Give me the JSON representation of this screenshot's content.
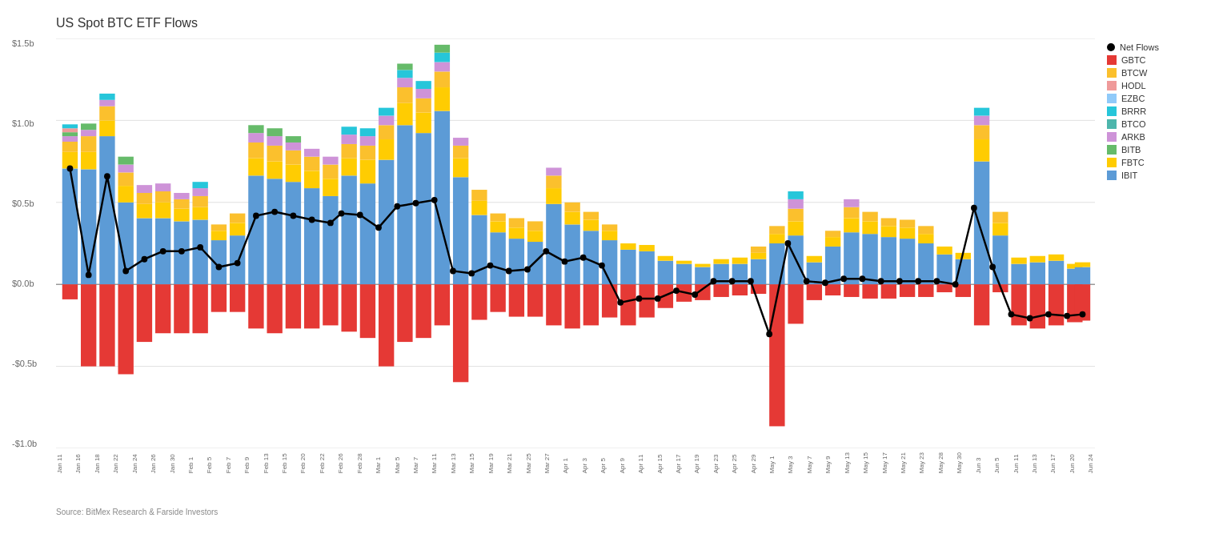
{
  "title": "US Spot BTC ETF Flows",
  "source": "Source: BitMex Research & Farside Investors",
  "yAxis": {
    "labels": [
      "$1.5b",
      "$1.0b",
      "$0.5b",
      "$0.0b",
      "-$0.5b",
      "-$1.0b"
    ]
  },
  "legend": {
    "items": [
      {
        "label": "Net Flows",
        "color": "#000000",
        "type": "dot"
      },
      {
        "label": "GBTC",
        "color": "#e53935",
        "type": "rect"
      },
      {
        "label": "BTCW",
        "color": "#fbc02d",
        "type": "rect"
      },
      {
        "label": "HODL",
        "color": "#ef9a9a",
        "type": "rect"
      },
      {
        "label": "EZBC",
        "color": "#90caf9",
        "type": "rect"
      },
      {
        "label": "BRRR",
        "color": "#26c6da",
        "type": "rect"
      },
      {
        "label": "BTCO",
        "color": "#4db6ac",
        "type": "rect"
      },
      {
        "label": "ARKB",
        "color": "#ce93d8",
        "type": "rect"
      },
      {
        "label": "BITB",
        "color": "#66bb6a",
        "type": "rect"
      },
      {
        "label": "FBTC",
        "color": "#ffcc02",
        "type": "rect"
      },
      {
        "label": "IBIT",
        "color": "#5c9bd6",
        "type": "rect"
      }
    ]
  },
  "xLabels": [
    "Jan 11",
    "Jan 16",
    "Jan 18",
    "Jan 22",
    "Jan 24",
    "Jan 26",
    "Jan 30",
    "Feb 1",
    "Feb 5",
    "Feb 7",
    "Feb 9",
    "Feb 13",
    "Feb 15",
    "Feb 20",
    "Feb 22",
    "Feb 26",
    "Feb 28",
    "Mar 1",
    "Mar 5",
    "Mar 7",
    "Mar 11",
    "Mar 13",
    "Mar 15",
    "Mar 19",
    "Mar 21",
    "Mar 25",
    "Mar 27",
    "Apr 1",
    "Apr 3",
    "Apr 5",
    "Apr 9",
    "Apr 11",
    "Apr 15",
    "Apr 17",
    "Apr 19",
    "Apr 23",
    "Apr 25",
    "Apr 29",
    "May 1",
    "May 3",
    "May 7",
    "May 9",
    "May 13",
    "May 15",
    "May 17",
    "May 21",
    "May 23",
    "May 28",
    "May 30",
    "Jun 3",
    "Jun 5",
    "Jun 11",
    "Jun 13",
    "Jun 17",
    "Jun 20",
    "Jun 24"
  ]
}
